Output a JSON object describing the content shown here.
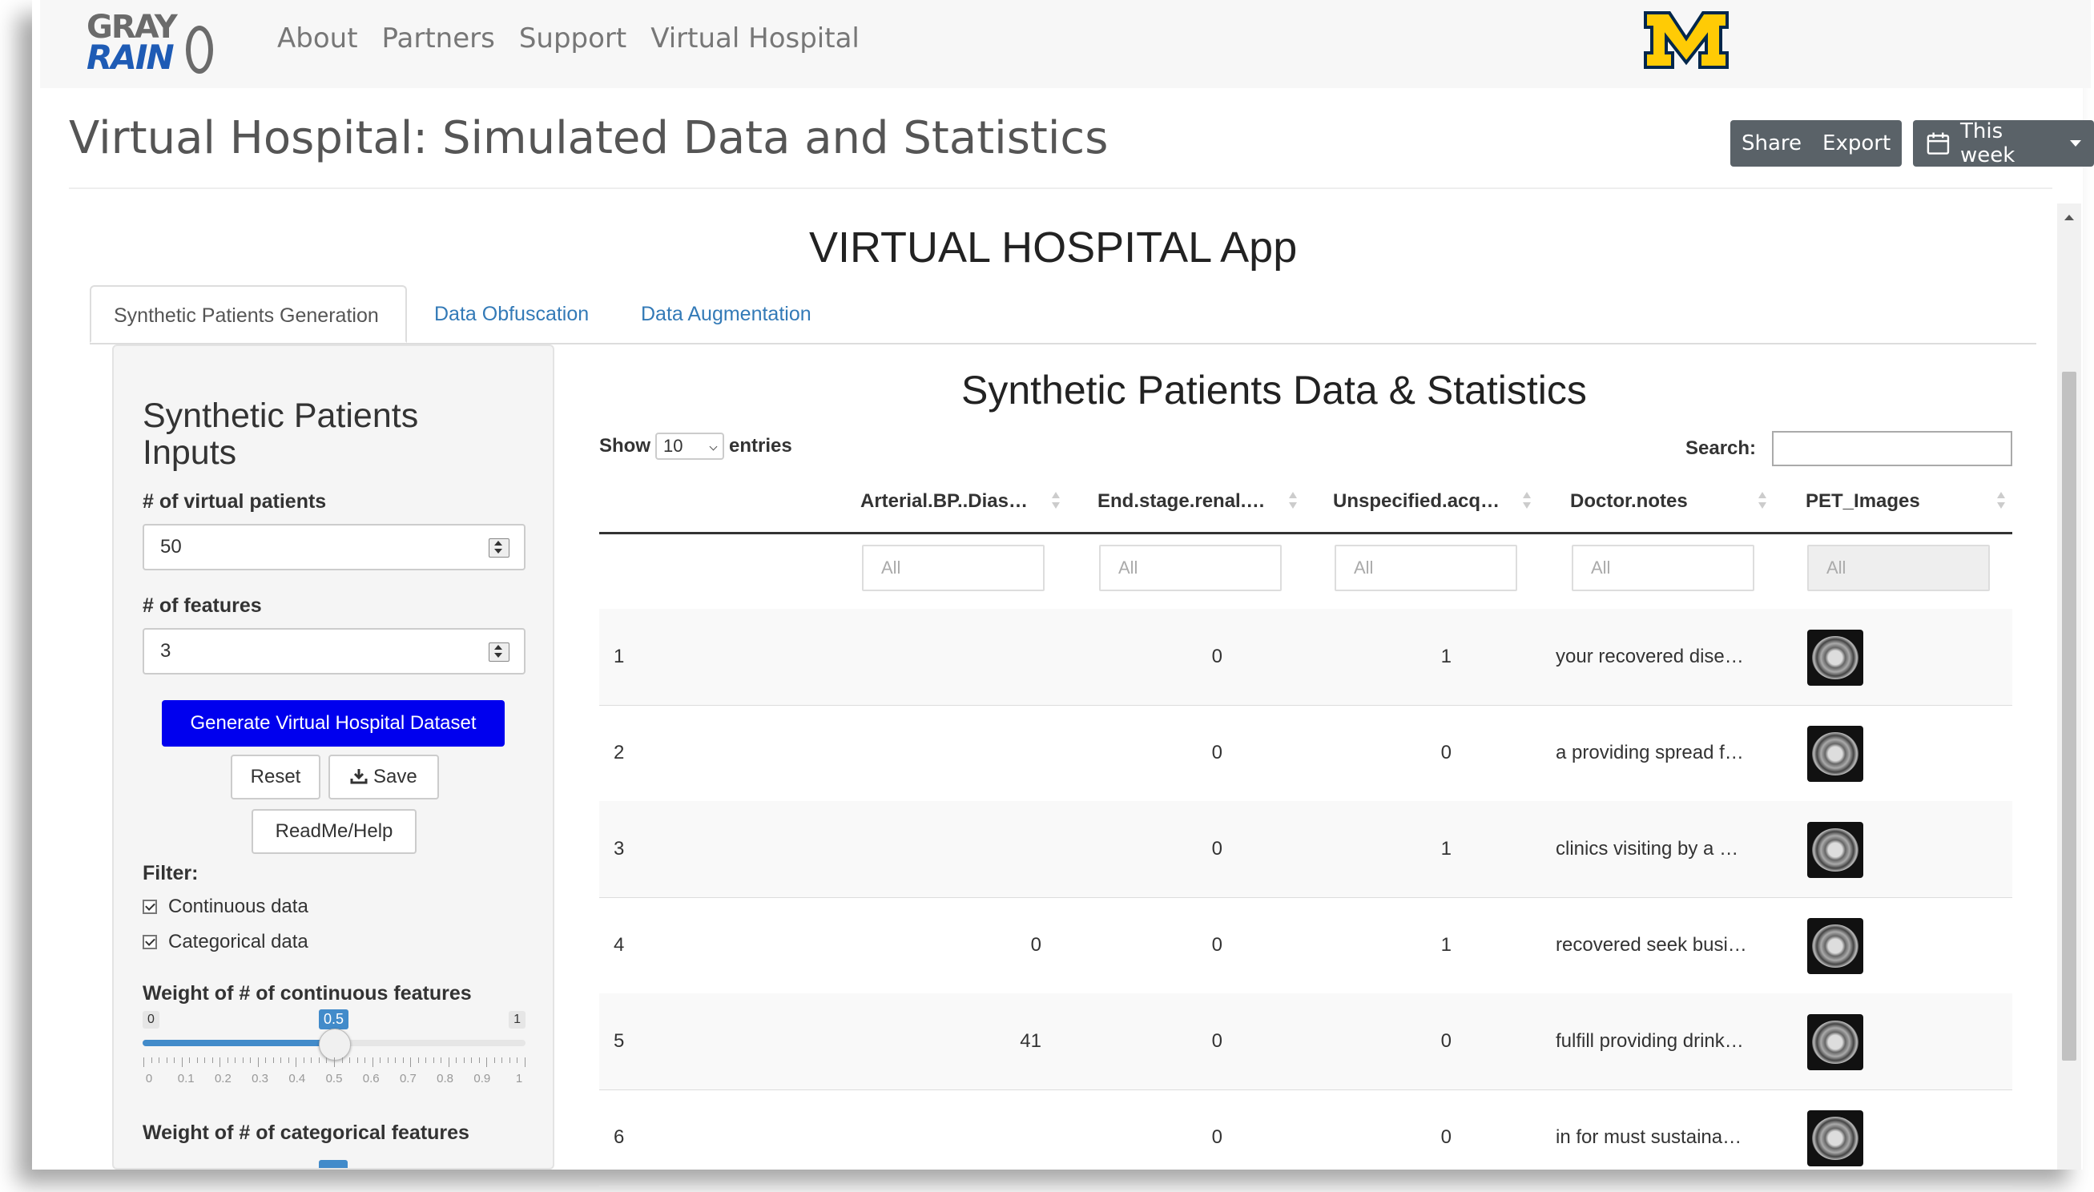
{
  "logo": {
    "line1": "GRAY",
    "line2": "RAIN"
  },
  "nav": {
    "links": [
      "About",
      "Partners",
      "Support",
      "Virtual Hospital"
    ]
  },
  "colors": {
    "brand_maize": "#ffcb05",
    "brand_blue": "#00274c",
    "primary_button": "#0000ee",
    "link": "#337ab7",
    "slider": "#428bca"
  },
  "page": {
    "title": "Virtual Hospital: Simulated Data and Statistics"
  },
  "header_buttons": {
    "share": "Share",
    "export": "Export",
    "range": "This week",
    "range_icon": "calendar-icon"
  },
  "app": {
    "title": "VIRTUAL HOSPITAL App",
    "tabs": [
      "Synthetic Patients Generation",
      "Data Obfuscation",
      "Data Augmentation"
    ],
    "active_tab": 0
  },
  "sidebar": {
    "title": "Synthetic Patients Inputs",
    "patients_label": "# of virtual patients",
    "patients_value": "50",
    "features_label": "# of features",
    "features_value": "3",
    "generate_button": "Generate Virtual Hospital Dataset",
    "reset_button": "Reset",
    "save_button": "Save",
    "save_icon": "download-icon",
    "help_button": "ReadMe/Help",
    "filter_label": "Filter:",
    "filters": [
      {
        "label": "Continuous data",
        "checked": true
      },
      {
        "label": "Categorical data",
        "checked": true
      }
    ],
    "cont_weight_label": "Weight of # of continuous features",
    "cont_slider": {
      "min": "0",
      "max": "1",
      "value": "0.5",
      "value_fraction": 0.5,
      "grid": [
        "0",
        "0.1",
        "0.2",
        "0.3",
        "0.4",
        "0.5",
        "0.6",
        "0.7",
        "0.8",
        "0.9",
        "1"
      ]
    },
    "cat_weight_label": "Weight of # of categorical features"
  },
  "main": {
    "title": "Synthetic Patients Data & Statistics",
    "show_label": "Show",
    "show_value": "10",
    "entries_label": "entries",
    "search_label": "Search:",
    "columns": [
      "Arterial.BP..Dias…",
      "End.stage.renal.…",
      "Unspecified.acq…",
      "Doctor.notes",
      "PET_Images"
    ],
    "filter_placeholder": "All",
    "rows": [
      {
        "id": "1",
        "c1": "",
        "c2": "0",
        "c3": "1",
        "notes": "your recovered dise…"
      },
      {
        "id": "2",
        "c1": "",
        "c2": "0",
        "c3": "0",
        "notes": "a providing spread f…"
      },
      {
        "id": "3",
        "c1": "",
        "c2": "0",
        "c3": "1",
        "notes": "clinics visiting by a …"
      },
      {
        "id": "4",
        "c1": "0",
        "c2": "0",
        "c3": "1",
        "notes": "recovered seek busi…"
      },
      {
        "id": "5",
        "c1": "41",
        "c2": "0",
        "c3": "0",
        "notes": "fulfill providing drink…"
      },
      {
        "id": "6",
        "c1": "",
        "c2": "0",
        "c3": "0",
        "notes": "in for must sustaina…"
      }
    ]
  }
}
